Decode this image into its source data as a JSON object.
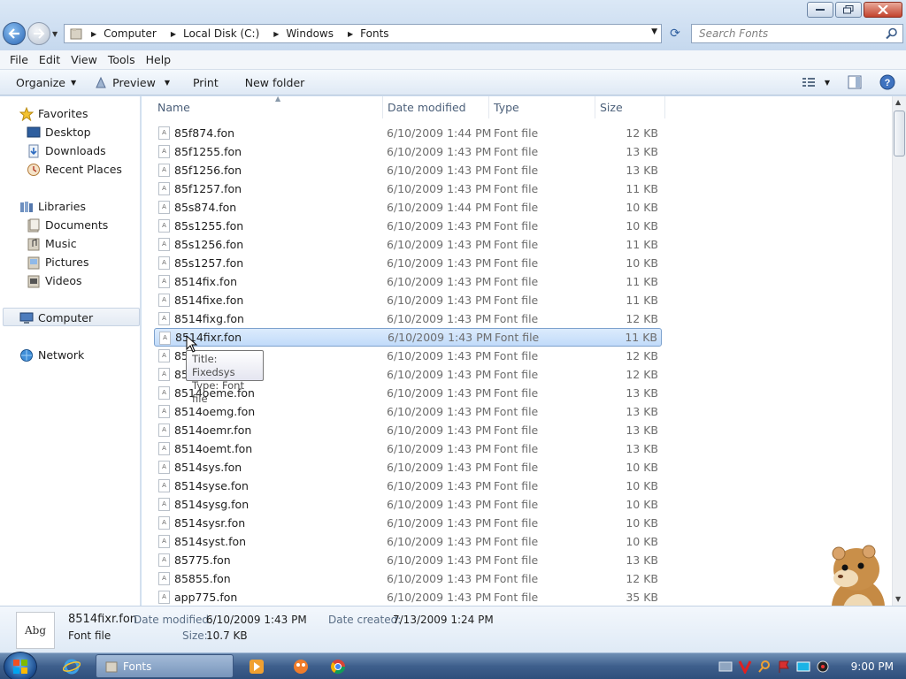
{
  "window": {
    "buttons": {
      "minimize": "minimize",
      "maximize": "maximize",
      "close": "close"
    }
  },
  "address": {
    "crumbs": [
      "Computer",
      "Local Disk (C:)",
      "Windows",
      "Fonts"
    ]
  },
  "search": {
    "placeholder": "Search Fonts"
  },
  "menubar": {
    "items": [
      "File",
      "Edit",
      "View",
      "Tools",
      "Help"
    ]
  },
  "toolbar": {
    "organize": "Organize",
    "preview": "Preview",
    "print": "Print",
    "new_folder": "New folder"
  },
  "navpane": {
    "favorites": "Favorites",
    "desktop": "Desktop",
    "downloads": "Downloads",
    "recent": "Recent Places",
    "libraries": "Libraries",
    "documents": "Documents",
    "music": "Music",
    "pictures": "Pictures",
    "videos": "Videos",
    "computer": "Computer",
    "network": "Network"
  },
  "columns": {
    "name": "Name",
    "date": "Date modified",
    "type": "Type",
    "size": "Size"
  },
  "files": [
    {
      "name": "85f874.fon",
      "date": "6/10/2009 1:44 PM",
      "type": "Font file",
      "size": "12 KB"
    },
    {
      "name": "85f1255.fon",
      "date": "6/10/2009 1:43 PM",
      "type": "Font file",
      "size": "13 KB"
    },
    {
      "name": "85f1256.fon",
      "date": "6/10/2009 1:43 PM",
      "type": "Font file",
      "size": "13 KB"
    },
    {
      "name": "85f1257.fon",
      "date": "6/10/2009 1:43 PM",
      "type": "Font file",
      "size": "11 KB"
    },
    {
      "name": "85s874.fon",
      "date": "6/10/2009 1:44 PM",
      "type": "Font file",
      "size": "10 KB"
    },
    {
      "name": "85s1255.fon",
      "date": "6/10/2009 1:43 PM",
      "type": "Font file",
      "size": "10 KB"
    },
    {
      "name": "85s1256.fon",
      "date": "6/10/2009 1:43 PM",
      "type": "Font file",
      "size": "11 KB"
    },
    {
      "name": "85s1257.fon",
      "date": "6/10/2009 1:43 PM",
      "type": "Font file",
      "size": "10 KB"
    },
    {
      "name": "8514fix.fon",
      "date": "6/10/2009 1:43 PM",
      "type": "Font file",
      "size": "11 KB"
    },
    {
      "name": "8514fixe.fon",
      "date": "6/10/2009 1:43 PM",
      "type": "Font file",
      "size": "11 KB"
    },
    {
      "name": "8514fixg.fon",
      "date": "6/10/2009 1:43 PM",
      "type": "Font file",
      "size": "12 KB"
    },
    {
      "name": "8514fixr.fon",
      "date": "6/10/2009 1:43 PM",
      "type": "Font file",
      "size": "11 KB"
    },
    {
      "name": "85",
      "date": "6/10/2009 1:43 PM",
      "type": "Font file",
      "size": "12 KB"
    },
    {
      "name": "85",
      "date": "6/10/2009 1:43 PM",
      "type": "Font file",
      "size": "12 KB"
    },
    {
      "name": "8514oeme.fon",
      "date": "6/10/2009 1:43 PM",
      "type": "Font file",
      "size": "13 KB"
    },
    {
      "name": "8514oemg.fon",
      "date": "6/10/2009 1:43 PM",
      "type": "Font file",
      "size": "13 KB"
    },
    {
      "name": "8514oemr.fon",
      "date": "6/10/2009 1:43 PM",
      "type": "Font file",
      "size": "13 KB"
    },
    {
      "name": "8514oemt.fon",
      "date": "6/10/2009 1:43 PM",
      "type": "Font file",
      "size": "13 KB"
    },
    {
      "name": "8514sys.fon",
      "date": "6/10/2009 1:43 PM",
      "type": "Font file",
      "size": "10 KB"
    },
    {
      "name": "8514syse.fon",
      "date": "6/10/2009 1:43 PM",
      "type": "Font file",
      "size": "10 KB"
    },
    {
      "name": "8514sysg.fon",
      "date": "6/10/2009 1:43 PM",
      "type": "Font file",
      "size": "10 KB"
    },
    {
      "name": "8514sysr.fon",
      "date": "6/10/2009 1:43 PM",
      "type": "Font file",
      "size": "10 KB"
    },
    {
      "name": "8514syst.fon",
      "date": "6/10/2009 1:43 PM",
      "type": "Font file",
      "size": "10 KB"
    },
    {
      "name": "85775.fon",
      "date": "6/10/2009 1:43 PM",
      "type": "Font file",
      "size": "13 KB"
    },
    {
      "name": "85855.fon",
      "date": "6/10/2009 1:43 PM",
      "type": "Font file",
      "size": "12 KB"
    },
    {
      "name": "app775.fon",
      "date": "6/10/2009 1:43 PM",
      "type": "Font file",
      "size": "35 KB"
    }
  ],
  "selected_index": 11,
  "tooltip": {
    "line1": "Title: Fixedsys",
    "line2": "Type: Font file"
  },
  "details": {
    "icon_text": "Abg",
    "name": "8514fixr.fon",
    "kind": "Font file",
    "modified_label": "Date modified:",
    "modified_value": "6/10/2009 1:43 PM",
    "size_label": "Size:",
    "size_value": "10.7 KB",
    "created_label": "Date created:",
    "created_value": "7/13/2009 1:24 PM"
  },
  "taskbar": {
    "fonts_task": "Fonts",
    "clock": "9:00 PM"
  },
  "colors": {
    "selection": "#c1dbfa",
    "toolbar": "#dfe9f5",
    "taskbar": "#3e5f8c"
  }
}
